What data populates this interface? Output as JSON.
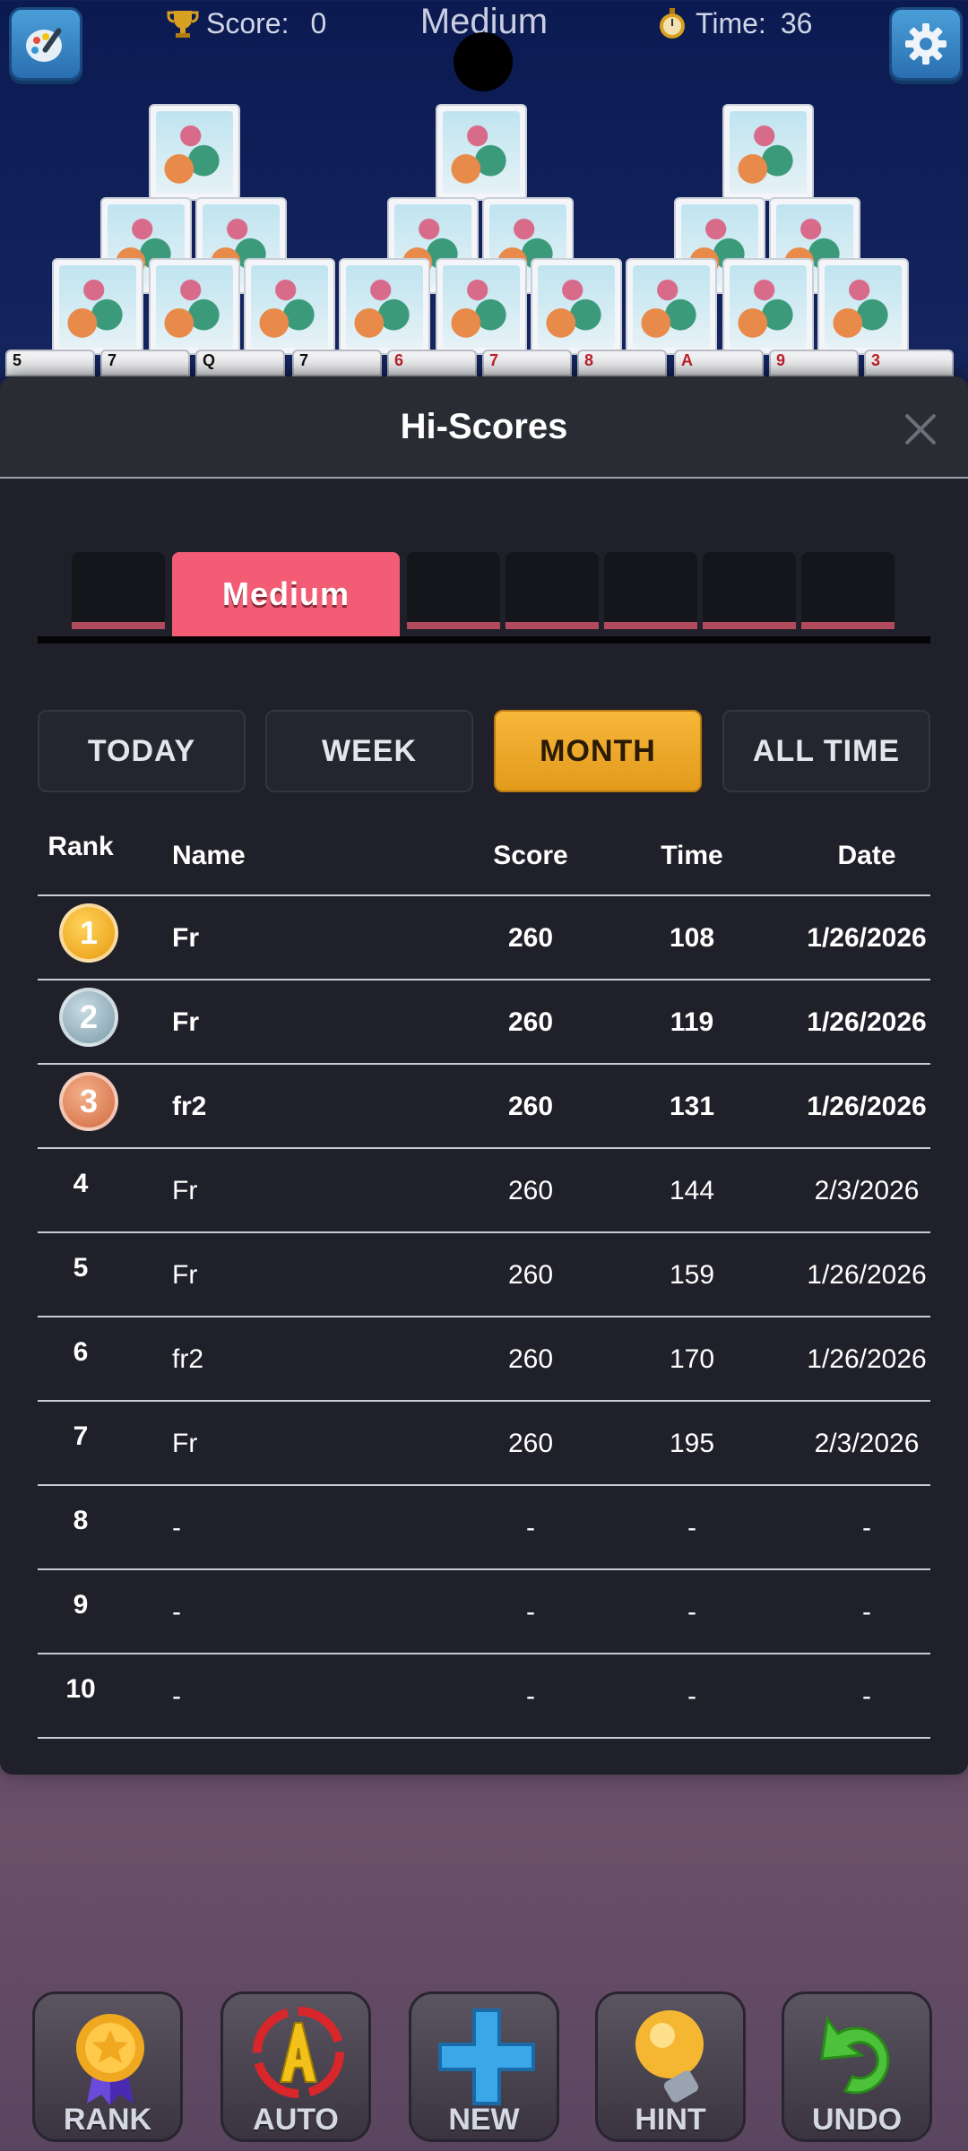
{
  "hud": {
    "score_label": "Score:",
    "score_value": "0",
    "difficulty": "Medium",
    "time_label": "Time:",
    "time_value": "36"
  },
  "visible_cards": [
    "5",
    "7",
    "Q",
    "7",
    "6",
    "7",
    "8",
    "A",
    "9",
    "3"
  ],
  "dialog": {
    "title": "Hi-Scores",
    "active_tab": "Medium",
    "periods": [
      "TODAY",
      "WEEK",
      "MONTH",
      "ALL TIME"
    ],
    "active_period": "MONTH",
    "columns": {
      "rank": "Rank",
      "name": "Name",
      "score": "Score",
      "time": "Time",
      "date": "Date"
    },
    "rows": [
      {
        "rank": "1",
        "name": "Fr",
        "score": "260",
        "time": "108",
        "date": "1/26/2026"
      },
      {
        "rank": "2",
        "name": "Fr",
        "score": "260",
        "time": "119",
        "date": "1/26/2026"
      },
      {
        "rank": "3",
        "name": "fr2",
        "score": "260",
        "time": "131",
        "date": "1/26/2026"
      },
      {
        "rank": "4",
        "name": "Fr",
        "score": "260",
        "time": "144",
        "date": "2/3/2026"
      },
      {
        "rank": "5",
        "name": "Fr",
        "score": "260",
        "time": "159",
        "date": "1/26/2026"
      },
      {
        "rank": "6",
        "name": "fr2",
        "score": "260",
        "time": "170",
        "date": "1/26/2026"
      },
      {
        "rank": "7",
        "name": "Fr",
        "score": "260",
        "time": "195",
        "date": "2/3/2026"
      },
      {
        "rank": "8",
        "name": "-",
        "score": "-",
        "time": "-",
        "date": "-"
      },
      {
        "rank": "9",
        "name": "-",
        "score": "-",
        "time": "-",
        "date": "-"
      },
      {
        "rank": "10",
        "name": "-",
        "score": "-",
        "time": "-",
        "date": "-"
      }
    ]
  },
  "bottom_buttons": [
    "RANK",
    "AUTO",
    "NEW",
    "HINT",
    "UNDO"
  ],
  "colors": {
    "tab_active": "#f25c74",
    "period_active": "#f7b739",
    "gold": "#f0b020",
    "silver": "#8fb0bc",
    "bronze": "#e0845a"
  }
}
